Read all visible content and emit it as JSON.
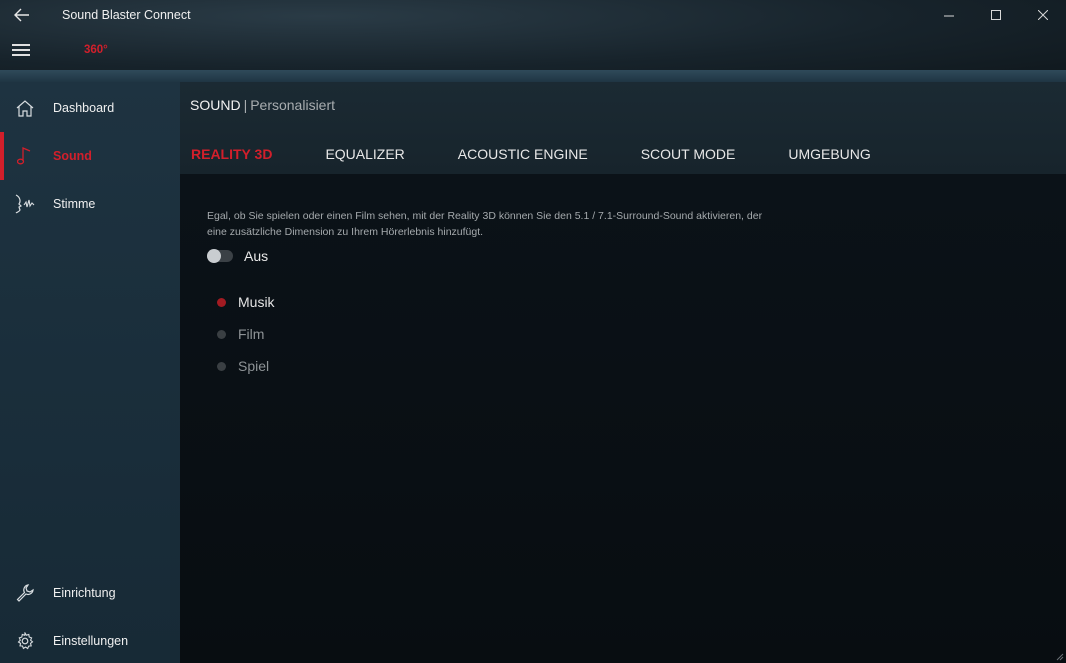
{
  "window": {
    "title": "Sound Blaster Connect",
    "badge": "360°"
  },
  "sidebar": {
    "items": [
      {
        "label": "Dashboard",
        "icon": "home-icon"
      },
      {
        "label": "Sound",
        "icon": "music-note-icon",
        "active": true
      },
      {
        "label": "Stimme",
        "icon": "voice-icon"
      },
      {
        "label": "Einrichtung",
        "icon": "wrench-icon"
      },
      {
        "label": "Einstellungen",
        "icon": "gear-icon"
      }
    ]
  },
  "header": {
    "section": "SOUND",
    "separator": "|",
    "subsection": "Personalisiert",
    "tabs": [
      {
        "label": "REALITY 3D",
        "active": true
      },
      {
        "label": "EQUALIZER"
      },
      {
        "label": "ACOUSTIC ENGINE"
      },
      {
        "label": "SCOUT MODE"
      },
      {
        "label": "UMGEBUNG"
      }
    ]
  },
  "content": {
    "description": "Egal, ob Sie spielen oder einen Film sehen, mit der Reality 3D können Sie den 5.1 / 7.1-Surround-Sound aktivieren, der eine zusätzliche Dimension zu Ihrem Hörerlebnis hinzufügt.",
    "toggle_label": "Aus",
    "toggle_on": false,
    "options": [
      {
        "label": "Musik",
        "selected": true
      },
      {
        "label": "Film"
      },
      {
        "label": "Spiel"
      }
    ]
  },
  "colors": {
    "accent": "#d21f2b",
    "sidebar": "#1c3140",
    "content_bg": "#0b1116"
  }
}
